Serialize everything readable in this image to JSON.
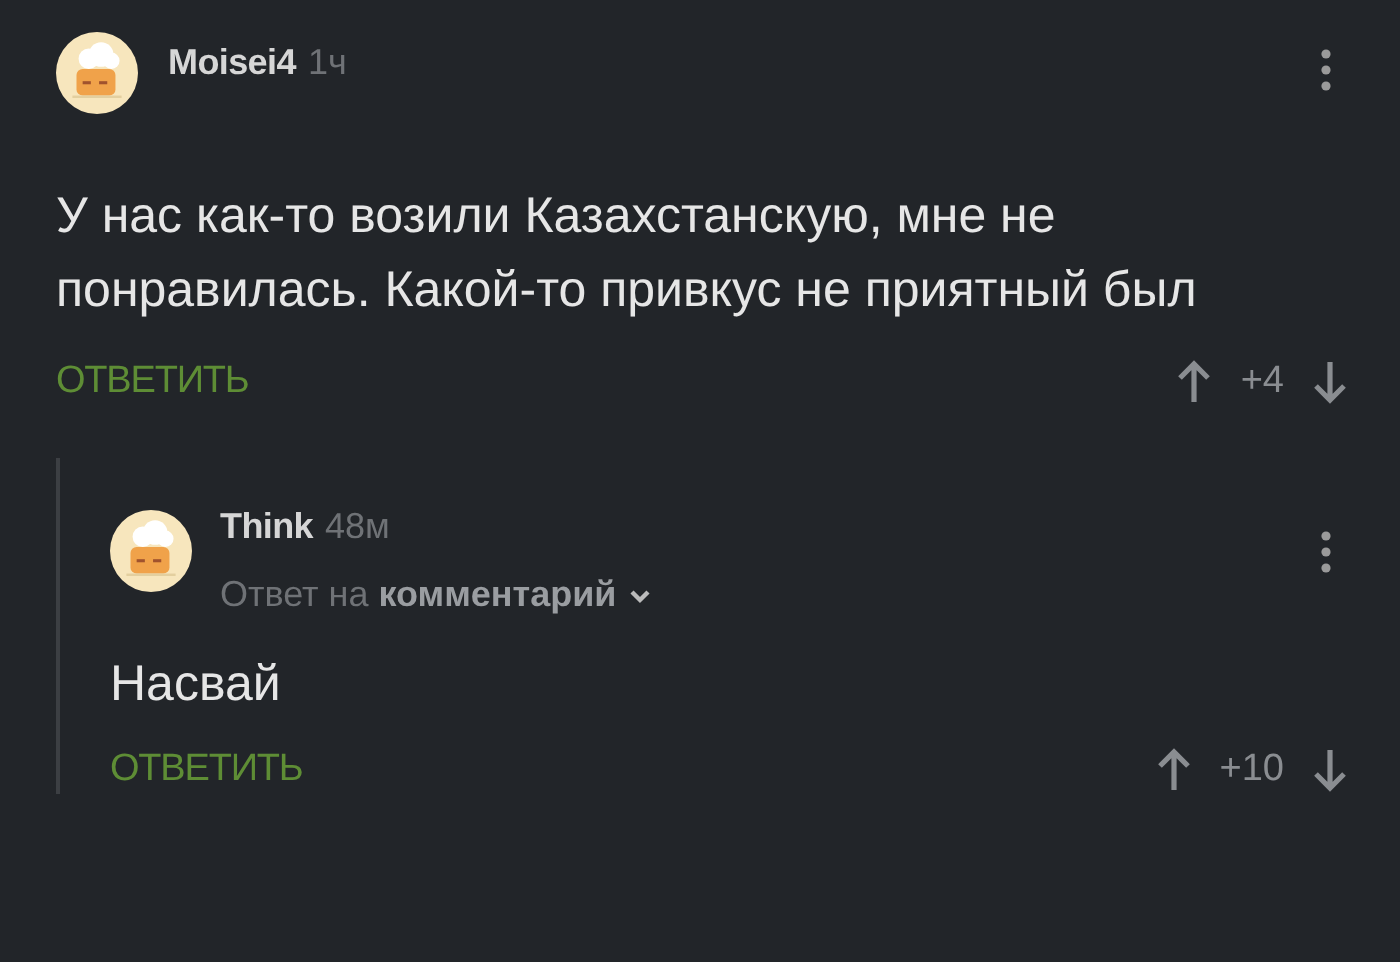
{
  "comments": [
    {
      "author": "Moisei4",
      "time": "1ч",
      "text": "У нас как-то возили Казахстанскую, мне не понравилась. Какой-то привкус не приятный был",
      "reply_label": "ОТВЕТИТЬ",
      "score": "+4",
      "children": [
        {
          "author": "Think",
          "time": "48м",
          "reply_to": "Ответ на **комментарий**",
          "text": "Насвай",
          "reply_label": "ОТВЕТИТЬ",
          "score": "+10"
        }
      ]
    }
  ]
}
